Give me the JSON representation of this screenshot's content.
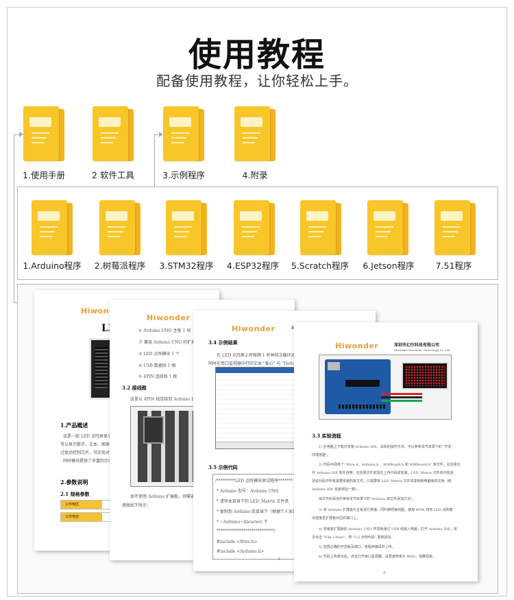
{
  "header": {
    "title": "使用教程",
    "subtitle": "配备使用教程，让你轻松上手。"
  },
  "top_folders": [
    {
      "label": "1.使用手册"
    },
    {
      "label": "2 软件工具"
    },
    {
      "label": "3.示例程序"
    },
    {
      "label": "4.附录"
    }
  ],
  "sub_folders": [
    {
      "label": "1.Arduino程序"
    },
    {
      "label": "2.树莓派程序"
    },
    {
      "label": "3.STM32程序"
    },
    {
      "label": "4.ESP32程序"
    },
    {
      "label": "5.Scratch程序"
    },
    {
      "label": "6.Jetson程序"
    },
    {
      "label": "7.51程序"
    }
  ],
  "colors": {
    "folder_front": "#f9c62a",
    "folder_back": "#f4b21e",
    "brand": "#e8a03a",
    "pcb_blue": "#1f5aa6",
    "led_red": "#e02020"
  },
  "docs": {
    "brand": "Hiwonder",
    "doc1": {
      "title_fragment": "LE",
      "section_overview": "1.产品概述",
      "overview_lines": [
        "这是一款 LED 点阵屏显示模块",
        "可以显示数字、文本、图案等内容",
        "过驱动控制芯片，可实现对点阵屏",
        "同时模块提供了丰富的示例程序"
      ],
      "section_params": "2.参数说明",
      "section_specs": "2.1 规格参数",
      "spec_rows": [
        "工作电压",
        "工作电流"
      ]
    },
    "doc2": {
      "list": [
        "①  Arduino UNO 主板 1 块",
        "②  兼容 Arduino UNO 的扩展板",
        "③  LED 点阵模块 1 个",
        "④  USB 数据线 1 根",
        "⑤  4PIN 连接线    1 根"
      ],
      "section_wiring": "3.2 接线图",
      "wiring_text": "这里以 4PIN 线连接到 Arduino 扩展板上",
      "footer_text": [
        "如不使用 Arduino 扩展板，则需通过杜邦",
        "意图如下所示："
      ]
    },
    "doc3": {
      "company": "深圳",
      "section_result": "3.4 示例结果",
      "result_lines": [
        "在 LED 点阵屏上将每隔 1 秒钟依次循环进行显示图",
        "同时在串口监视器中打印文本 \"爱心\" 与 \"Hello\"。"
      ],
      "section_code": "3.5 示例代码",
      "code_lines": [
        "/*********LED 点阵模块测试程序*******",
        " * Arduino 型号：Arduino UNO",
        " * 请将本目录下的 LED_Matrix 文件夹",
        " * 复制到 Arduino 库目录下（根据个人安装位置）",
        " * ~Arduino~libraries\\ 下",
        " ****************************/",
        "#include <Wire.h>",
        "#include <Arduino.h>"
      ],
      "page_number": "5"
    },
    "doc4": {
      "company": "深圳市幻尔科技有限公司",
      "company_en": "Shenzhen Hiwonder Technology Co.,Ltd",
      "section_steps": "3.3 实验流程",
      "steps": [
        "1) 在电脑上下载并安装 Arduino IDE，具体的操作方法，可以参考本节目录下的 \"开发",
        "环境搭建\"。",
        "2) 代码中调用了 \"Wire.h、Arduino.h 、WMBoard.h 和 WMBoard.h\" 库文件，在烧录文",
        "件 Arduino IDE 软件自带，在烧录文件前需在上传代码前安装，LED_Matrix 文件夹内包含",
        "测试代码中所有需要安装的库文件，只需要将 LED_Matrix 文件夹复制到电脑库的文档（和",
        "Arduino IDE 安装地址一致）。",
        "库文件的添加可参考本节目录下的\"Arduino 库文件添加方法\"。",
        "3) 将 Arduino 扩展板与主板进行拼接，同时参照接线图，使用 4PIN 线将 LED 点阵模",
        "块连接至扩展板对应的接口上。",
        "4) 将装有扩展板的 Arduino UNO 开发板通过 USB 线接入电脑，打开 Arduino IDE，依",
        "次点击 \"File->New\"，将 \"3.5 示例代码\" 复制进去。",
        "5) 选择正确的开发板及端口，将程序编译并上传。",
        "6) 代码上传成功后，点击打开串口监视器，设置波特率为 9600，观察现象。"
      ],
      "page_number": "4"
    }
  }
}
